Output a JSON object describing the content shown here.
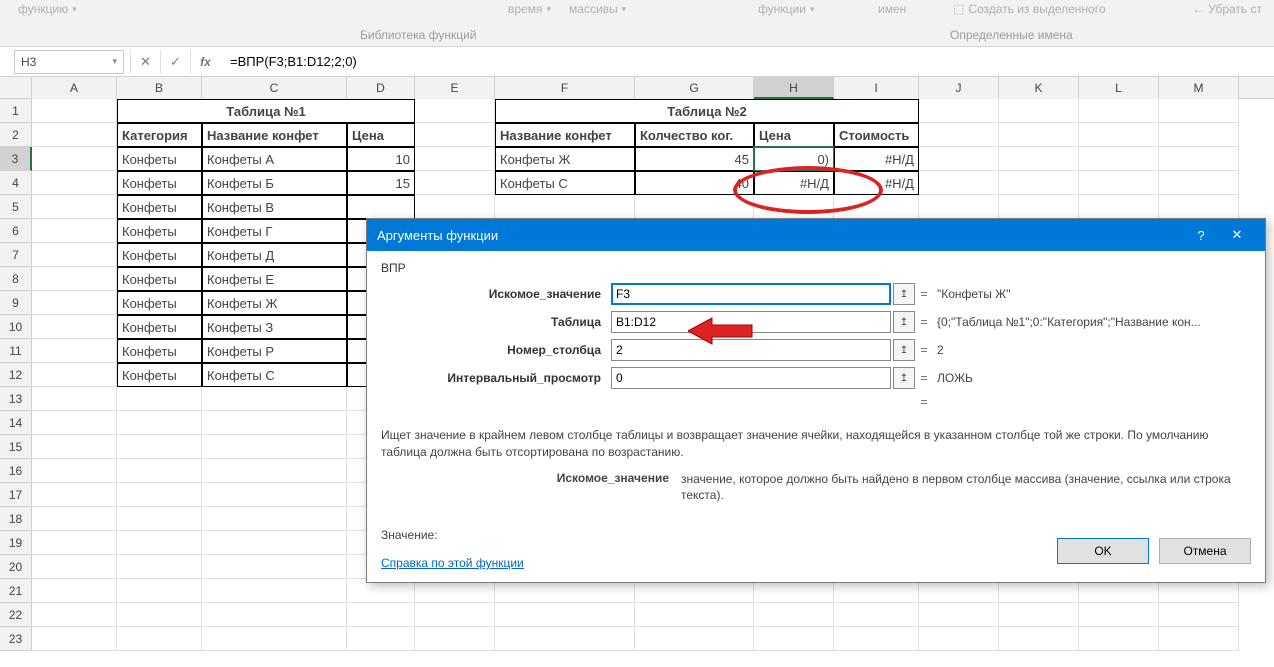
{
  "ribbon": {
    "items_left": [
      "функцию",
      "",
      "",
      "",
      "",
      "время",
      "массивы",
      "",
      "функции",
      "имен"
    ],
    "items_right": [
      "Создать из выделенного",
      "Убрать ст"
    ],
    "group1": "Библиотека функций",
    "group2": "Определенные имена"
  },
  "namebox": "H3",
  "fx_label": "fx",
  "formula": "=ВПР(F3;B1:D12;2;0)",
  "columns": [
    "A",
    "B",
    "C",
    "D",
    "E",
    "F",
    "G",
    "H",
    "I",
    "J",
    "K",
    "L",
    "M"
  ],
  "selected_col": "H",
  "selected_row": 3,
  "table1": {
    "title": "Таблица №1",
    "headers": [
      "Категория",
      "Название конфет",
      "Цена"
    ],
    "rows": [
      [
        "Конфеты",
        "Конфеты А",
        "10"
      ],
      [
        "Конфеты",
        "Конфеты Б",
        "15"
      ],
      [
        "Конфеты",
        "Конфеты В",
        ""
      ],
      [
        "Конфеты",
        "Конфеты Г",
        ""
      ],
      [
        "Конфеты",
        "Конфеты Д",
        ""
      ],
      [
        "Конфеты",
        "Конфеты Е",
        ""
      ],
      [
        "Конфеты",
        "Конфеты Ж",
        ""
      ],
      [
        "Конфеты",
        "Конфеты З",
        ""
      ],
      [
        "Конфеты",
        "Конфеты Р",
        ""
      ],
      [
        "Конфеты",
        "Конфеты С",
        ""
      ]
    ]
  },
  "table2": {
    "title": "Таблица №2",
    "headers": [
      "Название конфет",
      "Колчество ког.",
      "Цена",
      "Стоимость"
    ],
    "rows": [
      [
        "Конфеты Ж",
        "45",
        "0)",
        "#Н/Д"
      ],
      [
        "Конфеты С",
        "40",
        "#Н/Д",
        "#Н/Д"
      ]
    ]
  },
  "dialog": {
    "title": "Аргументы функции",
    "fn": "ВПР",
    "args": [
      {
        "label": "Искомое_значение",
        "value": "F3",
        "result": "\"Конфеты Ж\""
      },
      {
        "label": "Таблица",
        "value": "B1:D12",
        "result": "{0;\"Таблица №1\";0:\"Категория\";\"Название кон..."
      },
      {
        "label": "Номер_столбца",
        "value": "2",
        "result": "2"
      },
      {
        "label": "Интервальный_просмотр",
        "value": "0",
        "result": "ЛОЖЬ"
      }
    ],
    "final_eq": "=",
    "desc": "Ищет значение в крайнем левом столбце таблицы и возвращает значение ячейки, находящейся в указанном столбце той же строки. По умолчанию таблица должна быть отсортирована по возрастанию.",
    "arg_desc_label": "Искомое_значение",
    "arg_desc_text": "значение, которое должно быть найдено в первом столбце массива (значение, ссылка или строка текста).",
    "result_label": "Значение:",
    "help": "Справка по этой функции",
    "ok": "OK",
    "cancel": "Отмена",
    "help_icon": "?",
    "close_icon": "✕"
  }
}
